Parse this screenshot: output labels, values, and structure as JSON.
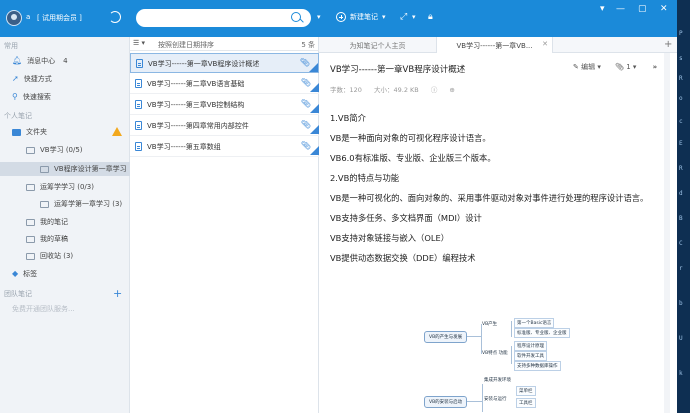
{
  "titlebar": {
    "username": "a",
    "trial_label": "[ 试用期会员 ]",
    "search_value": "",
    "search_dropdown": "▾",
    "new_note_label": "新建笔记",
    "new_note_dropdown": "▾",
    "window_controls": [
      "▾",
      "—",
      "▢",
      "✕"
    ]
  },
  "sidebar": {
    "section_common": "常用",
    "messages_label": "消息中心",
    "messages_count": "4",
    "shortcuts_label": "快捷方式",
    "quick_search_label": "快速搜索",
    "section_personal": "个人笔记",
    "folders_label": "文件夹",
    "vb_folder_label": "VB学习  (0/5)",
    "vb_ch1_label": "VB程序设计第一章学习",
    "c_folder_label": "运筹学学习  (0/3)",
    "c_ch1_label": "运筹学第一章学习  (3)",
    "my_notes_label": "我的笔记",
    "drafts_label": "我的草稿",
    "trash_label": "回收站  (3)",
    "tags_label": "标签",
    "section_team": "团队笔记",
    "team_placeholder": "免费开通团队服务..."
  },
  "list": {
    "sort_label": "按照创建日期排序",
    "count": "5 条",
    "notes": [
      {
        "title": "VB学习------第一章VB程序设计概述"
      },
      {
        "title": "VB学习------第二章VB语言基础"
      },
      {
        "title": "VB学习------第三章VB控制结构"
      },
      {
        "title": "VB学习------第四章常用内部控件"
      },
      {
        "title": "VB学习------第五章数组"
      }
    ]
  },
  "tabs": [
    {
      "label": "为知笔记个人主页"
    },
    {
      "label": "VB学习------第一章VB..."
    }
  ],
  "document": {
    "title": "VB学习------第一章VB程序设计概述",
    "edit_label": "编辑",
    "attachments_count": "1",
    "meta_words": "字数：120",
    "meta_size": "大小：49.2 KB",
    "paragraphs": [
      "1.VB简介",
      "VB是一种面向对象的可视化程序设计语言。",
      "VB6.0有标准版、专业版、企业版三个版本。",
      "2.VB的特点与功能",
      "VB是一种可视化的、面向对象的、采用事件驱动对象对事件进行处理的程序设计语言。",
      "VB支持多任务、多文档界面（MDI）设计",
      "VB支持对象链接与嵌入（OLE）",
      "VB提供动态数据交换（DDE）编程技术"
    ],
    "mindmap": {
      "root": "VB的产生与发展",
      "branch1": "VB产生",
      "branch2": "VB特点 功能",
      "leaf1": "第一个Basic语言",
      "leaf2": "标准版、专业版、企业版",
      "leaf3": "程序设计原理",
      "leaf4": "软件开发工具",
      "leaf5": "支持多种数据库操作",
      "root2": "VB的安装与启动",
      "branch3": "集成开发环境",
      "branch4": "安装与运行",
      "leaf6": "菜单栏",
      "leaf7": "工具栏"
    }
  },
  "desktop_text": [
    "P",
    "s",
    "R",
    "o",
    "c",
    "E",
    "R",
    "d",
    "B",
    "C",
    "r",
    "b",
    "U",
    "k"
  ]
}
